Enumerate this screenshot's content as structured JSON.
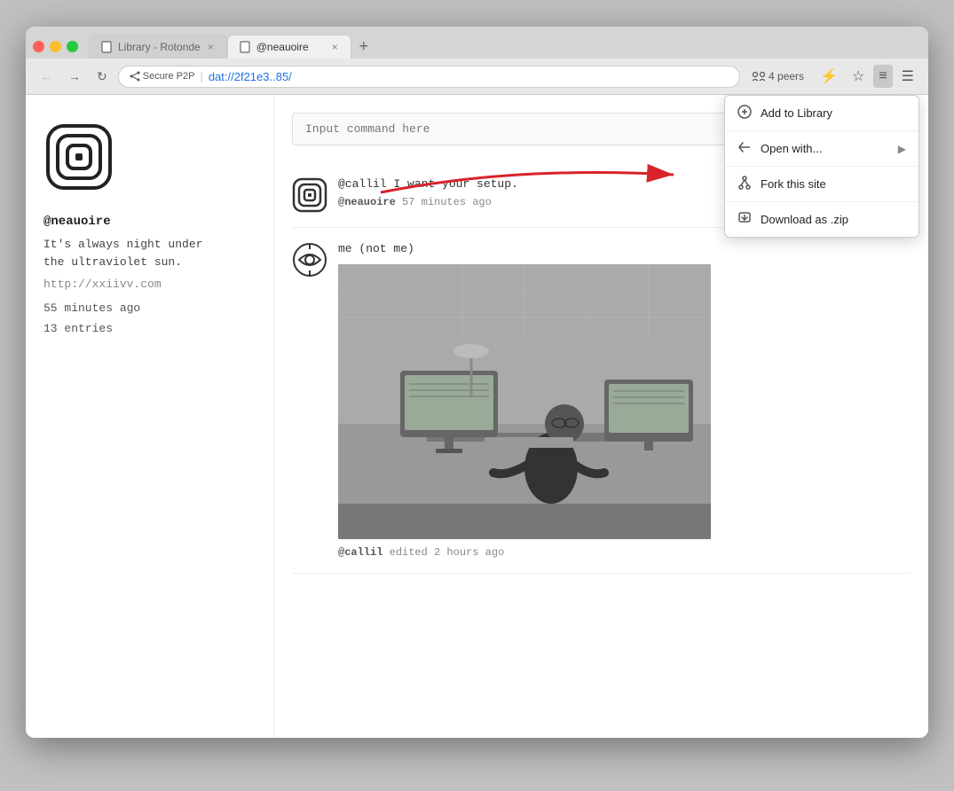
{
  "browser": {
    "tabs": [
      {
        "id": "library",
        "label": "Library - Rotonde",
        "active": false
      },
      {
        "id": "neauoire",
        "label": "@neauoire",
        "active": true
      }
    ],
    "address": {
      "secure_label": "Secure P2P",
      "url": "dat://2f21e3..85/"
    },
    "peers": "4 peers",
    "toolbar": {
      "back": "←",
      "forward": "→",
      "refresh": "↻"
    }
  },
  "dropdown": {
    "items": [
      {
        "id": "add-to-library",
        "icon": "⊕",
        "label": "Add to Library",
        "has_arrow": false
      },
      {
        "id": "open-with",
        "icon": "↩",
        "label": "Open with...",
        "has_arrow": true
      },
      {
        "id": "fork-this-site",
        "icon": "⑂",
        "label": "Fork this site",
        "has_arrow": false
      },
      {
        "id": "download-as-zip",
        "icon": "↓",
        "label": "Download as .zip",
        "has_arrow": false
      }
    ]
  },
  "sidebar": {
    "username": "@neauoire",
    "bio_line1": "It's always night under",
    "bio_line2": "the ultraviolet sun.",
    "link": "http://xxiivv.com",
    "time_ago": "55 minutes ago",
    "entries": "13 entries"
  },
  "posts": [
    {
      "id": "post-1",
      "text": "@callil I want your setup.",
      "username": "@neauoire",
      "time": "57 minutes ago",
      "has_image": false
    },
    {
      "id": "post-2",
      "text": "me (not me)",
      "username": "@callil",
      "time": "edited 2 hours ago",
      "has_image": true
    }
  ],
  "command_placeholder": "Input command here",
  "icons": {
    "share": "⋈",
    "lightning": "⚡",
    "star": "☆",
    "menu": "≡"
  }
}
